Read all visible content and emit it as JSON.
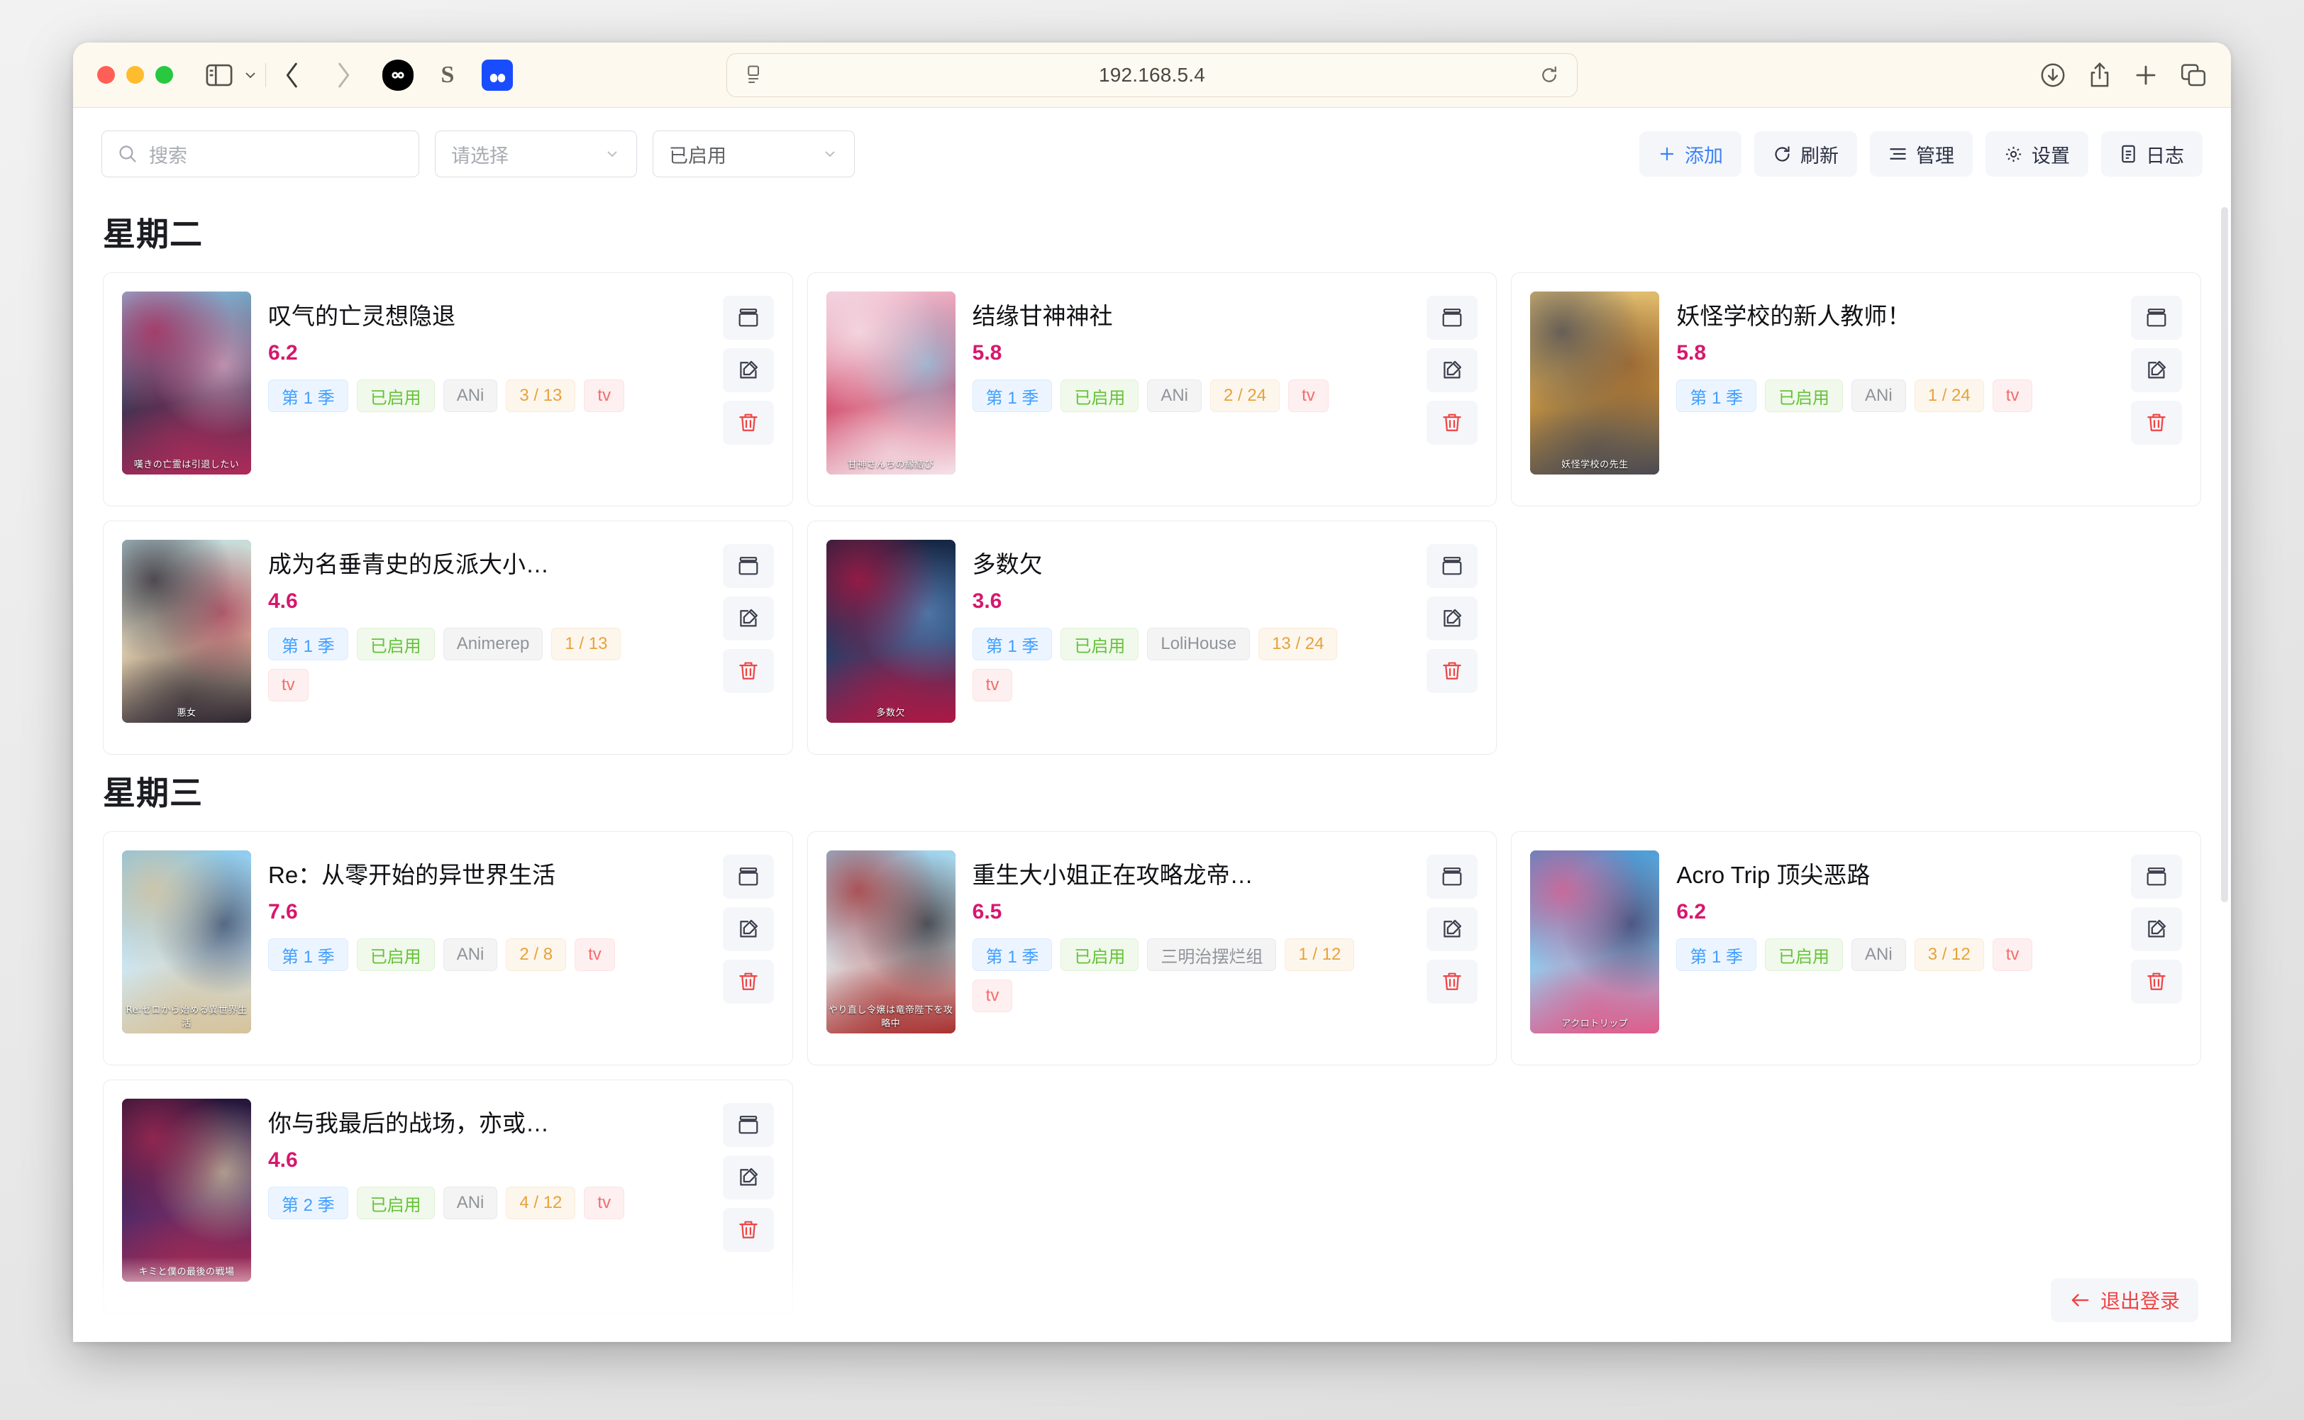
{
  "browser": {
    "url": "192.168.5.4",
    "traffic_lights": [
      "close",
      "minimize",
      "zoom"
    ],
    "icons": {
      "sidebar": "sidebar-icon",
      "sidebar_chevron": "chevron-down-icon",
      "back": "back-arrow-icon",
      "forward": "forward-arrow-icon",
      "favicon_infinity": "infinity-favicon-icon",
      "favicon_s": "s-favicon-icon",
      "favicon_blue": "blue-favicon-icon",
      "reader": "reader-view-icon",
      "reload": "reload-icon",
      "downloads": "download-icon",
      "share": "share-icon",
      "new_tab": "plus-icon",
      "tab_overview": "tab-overview-icon"
    }
  },
  "toolbar": {
    "search_placeholder": "搜索",
    "search_value": "",
    "search_icon": "search-icon",
    "filter_select_value": "请选择",
    "status_select_value": "已启用",
    "actions": [
      {
        "label": "添加",
        "icon": "plus-icon",
        "primary": true
      },
      {
        "label": "刷新",
        "icon": "refresh-icon",
        "primary": false
      },
      {
        "label": "管理",
        "icon": "list-icon",
        "primary": false
      },
      {
        "label": "设置",
        "icon": "gear-icon",
        "primary": false
      },
      {
        "label": "日志",
        "icon": "document-icon",
        "primary": false
      }
    ]
  },
  "card_actions": {
    "archive_icon": "archive-box-icon",
    "edit_icon": "edit-pencil-icon",
    "delete_icon": "trash-icon"
  },
  "footer": {
    "logout_label": "退出登录",
    "logout_icon": "arrow-left-icon"
  },
  "sections": [
    {
      "day": "星期二",
      "cards": [
        {
          "title": "叹气的亡灵想隐退",
          "score": "6.2",
          "season": "第 1 季",
          "status": "已启用",
          "group": "ANi",
          "progress": "3 / 13",
          "type": "tv",
          "poster_caption": "嘆きの亡霊は引退したい",
          "poster_colors": [
            "#8ec7e8",
            "#3a3350",
            "#b02a5a",
            "#e7a9c8"
          ]
        },
        {
          "title": "结缘甘神神社",
          "score": "5.8",
          "season": "第 1 季",
          "status": "已启用",
          "group": "ANi",
          "progress": "2 / 24",
          "type": "tv",
          "poster_caption": "甘神さんちの縁結び",
          "poster_colors": [
            "#f4c9da",
            "#d24a6a",
            "#f5e3ea",
            "#8ad0ea"
          ]
        },
        {
          "title": "妖怪学校的新人教师！",
          "score": "5.8",
          "season": "第 1 季",
          "status": "已启用",
          "group": "ANi",
          "progress": "1 / 24",
          "type": "tv",
          "poster_caption": "妖怪学校の先生",
          "poster_colors": [
            "#e8c77a",
            "#c4913f",
            "#4a4a52",
            "#8a5a2e"
          ]
        },
        {
          "title": "成为名垂青史的反派大小…",
          "score": "4.6",
          "season": "第 1 季",
          "status": "已启用",
          "group": "Animerep",
          "progress": "1 / 13",
          "type": "tv",
          "poster_caption": "悪女",
          "poster_colors": [
            "#bfe0e6",
            "#e6d2b0",
            "#2d2530",
            "#9e2d4e"
          ]
        },
        {
          "title": "多数欠",
          "score": "3.6",
          "season": "第 1 季",
          "status": "已启用",
          "group": "LoliHouse",
          "progress": "13 / 24",
          "type": "tv",
          "poster_caption": "多数欠",
          "poster_colors": [
            "#12203a",
            "#24406b",
            "#b01743",
            "#5e8bbf"
          ]
        }
      ]
    },
    {
      "day": "星期三",
      "cards": [
        {
          "title": "Re：从零开始的异世界生活",
          "score": "7.6",
          "season": "第 1 季",
          "status": "已启用",
          "group": "ANi",
          "progress": "2 / 8",
          "type": "tv",
          "poster_caption": "Re:ゼロから始める異世界生活",
          "poster_colors": [
            "#7fc4ea",
            "#cfe9f7",
            "#d7c29a",
            "#2c3b5a"
          ]
        },
        {
          "title": "重生大小姐正在攻略龙帝…",
          "score": "6.5",
          "season": "第 1 季",
          "status": "已启用",
          "group": "三明治摆烂组",
          "progress": "1 / 12",
          "type": "tv",
          "poster_caption": "やり直し令嬢は竜帝陛下を攻略中",
          "poster_colors": [
            "#8fd0ef",
            "#e3e9ec",
            "#a8302f",
            "#1b1b22"
          ]
        },
        {
          "title": "Acro Trip 顶尖恶路",
          "score": "6.2",
          "season": "第 1 季",
          "status": "已启用",
          "group": "ANi",
          "progress": "3 / 12",
          "type": "tv",
          "poster_caption": "アクロトリップ",
          "poster_colors": [
            "#3f8fd0",
            "#8fd2f2",
            "#e05b8a",
            "#3a2f5e"
          ]
        },
        {
          "title": "你与我最后的战场，亦或…",
          "score": "4.6",
          "season": "第 2 季",
          "status": "已启用",
          "group": "ANi",
          "progress": "4 / 12",
          "type": "tv",
          "poster_caption": "キミと僕の最後の戦場",
          "poster_colors": [
            "#1a1030",
            "#4a2a6a",
            "#a82a52",
            "#d8c9a0"
          ]
        }
      ]
    }
  ]
}
